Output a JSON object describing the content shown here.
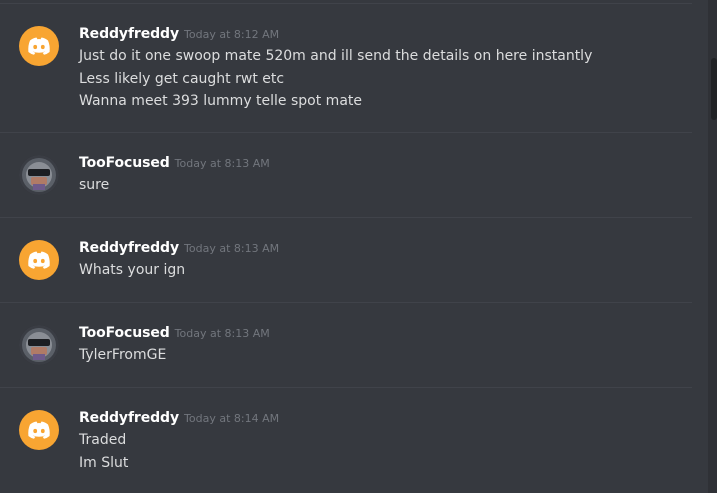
{
  "messages": [
    {
      "username": "Reddyfreddy",
      "timestamp": "Today at 8:12 AM",
      "avatar": "discord-logo-icon",
      "lines": [
        "Just do it one swoop mate 520m and ill send the details on here instantly",
        "Less likely get caught rwt etc",
        "Wanna meet 393 lummy telle spot mate"
      ]
    },
    {
      "username": "TooFocused",
      "timestamp": "Today at 8:13 AM",
      "avatar": "user-photo",
      "lines": [
        "sure"
      ]
    },
    {
      "username": "Reddyfreddy",
      "timestamp": "Today at 8:13 AM",
      "avatar": "discord-logo-icon",
      "lines": [
        "Whats your ign"
      ]
    },
    {
      "username": "TooFocused",
      "timestamp": "Today at 8:13 AM",
      "avatar": "user-photo",
      "lines": [
        "TylerFromGE"
      ]
    },
    {
      "username": "Reddyfreddy",
      "timestamp": "Today at 8:14 AM",
      "avatar": "discord-logo-icon",
      "lines": [
        "Traded",
        "Im Slut"
      ]
    }
  ],
  "colors": {
    "background": "#36393f",
    "discord_avatar": "#f8a532",
    "username": "#ffffff",
    "timestamp": "#72767d",
    "message_text": "#dcddde",
    "divider": "#40434a"
  }
}
